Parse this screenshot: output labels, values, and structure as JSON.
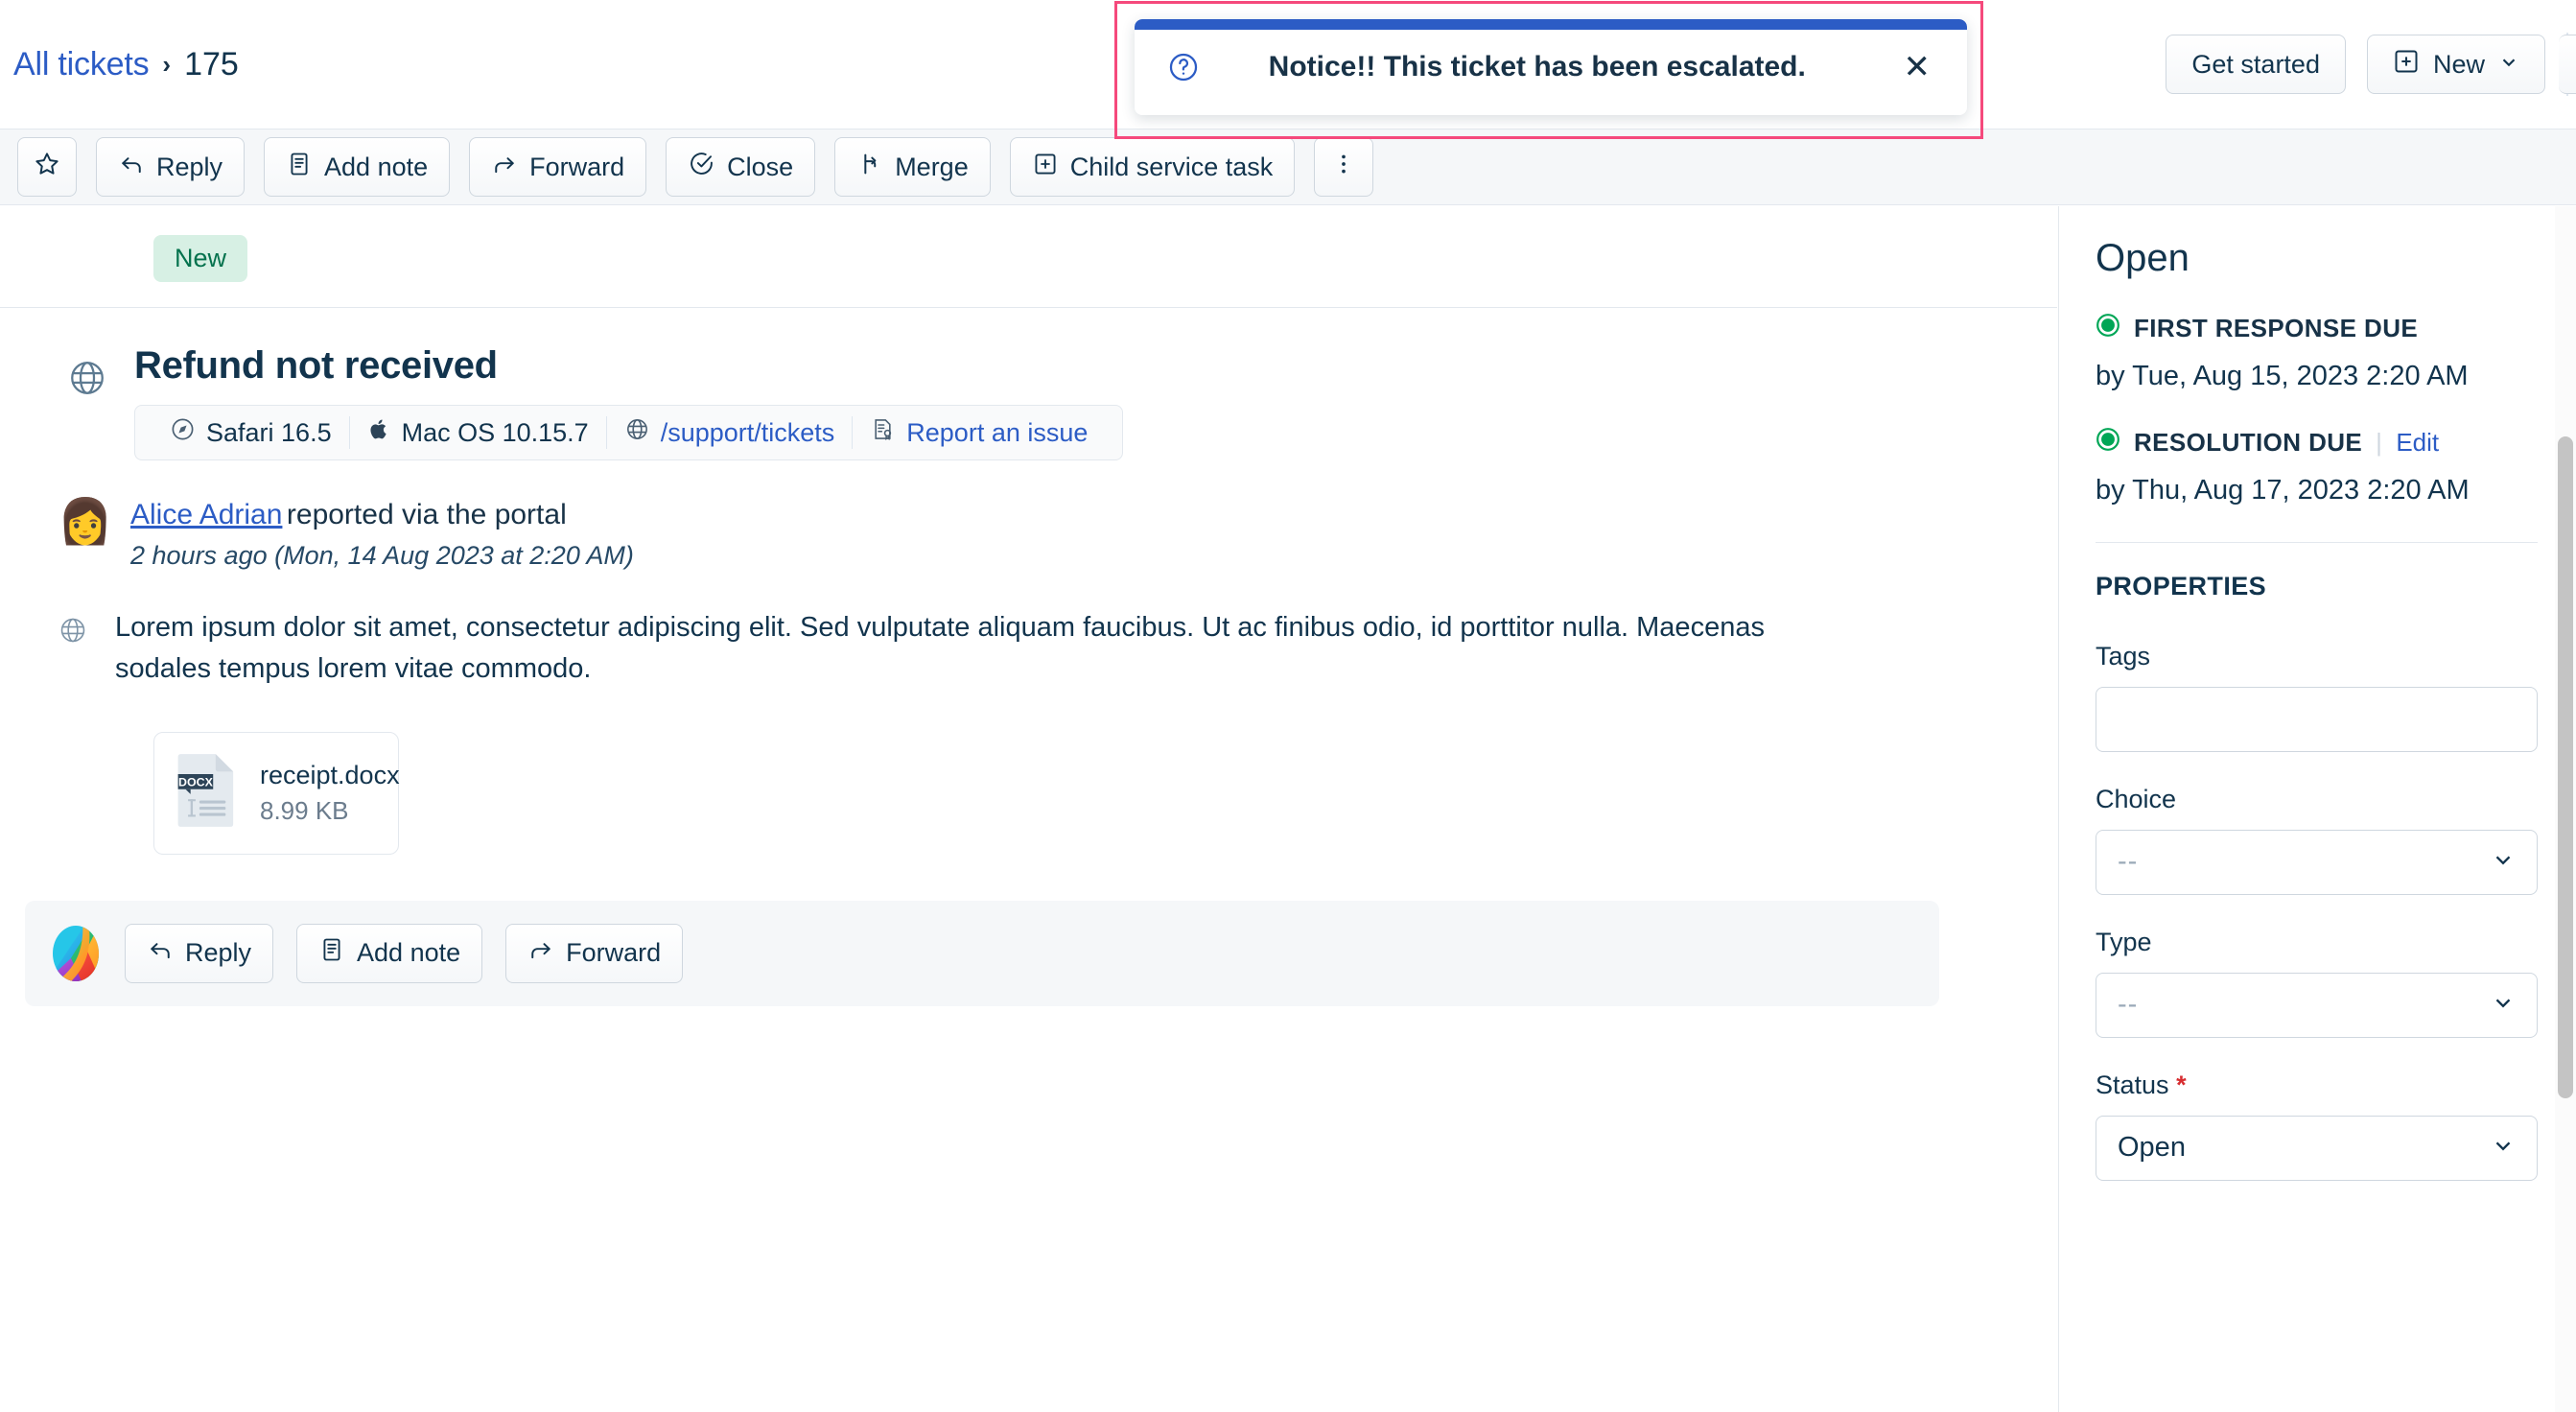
{
  "breadcrumb": {
    "root_label": "All tickets",
    "separator": "›",
    "current_label": "175"
  },
  "header": {
    "get_started_label": "Get started",
    "new_label": "New",
    "new_icon": "plus-square-icon",
    "new_caret": "chevron-down-icon"
  },
  "notification": {
    "icon": "question-circle-icon",
    "message": "Notice!! This ticket has been escalated.",
    "close_label": "✕",
    "accent_color": "#2c5cc5",
    "highlight_border_color": "#f5497c"
  },
  "toolbar": {
    "buttons": [
      {
        "label": "",
        "icon": "star-icon",
        "name": "favorite-button"
      },
      {
        "label": "Reply",
        "icon": "reply-arrow-icon",
        "name": "reply-button"
      },
      {
        "label": "Add note",
        "icon": "note-icon",
        "name": "add-note-button"
      },
      {
        "label": "Forward",
        "icon": "forward-arrow-icon",
        "name": "forward-button"
      },
      {
        "label": "Close",
        "icon": "check-circle-icon",
        "name": "close-ticket-button"
      },
      {
        "label": "Merge",
        "icon": "merge-icon",
        "name": "merge-button"
      },
      {
        "label": "Child service task",
        "icon": "plus-square-icon",
        "name": "child-service-task-button"
      },
      {
        "label": "",
        "icon": "kebab-menu-icon",
        "name": "more-actions-button"
      }
    ]
  },
  "ticket": {
    "status_badge": "New",
    "status_badge_color": "#04724d",
    "status_badge_bg": "#d7f0e4",
    "channel_icon": "globe-icon",
    "title": "Refund not received",
    "meta": [
      {
        "label": "Safari 16.5",
        "icon": "safari-icon",
        "link": false
      },
      {
        "label": "Mac OS 10.15.7",
        "icon": "apple-icon",
        "link": false
      },
      {
        "label": "/support/tickets",
        "icon": "globe-icon",
        "link": true
      },
      {
        "label": "Report an issue",
        "icon": "report-icon",
        "link": true
      }
    ],
    "reporter": {
      "avatar": "woman-avatar",
      "name": "Alice Adrian",
      "action": "reported via the portal",
      "timestamp": "2 hours ago (Mon, 14 Aug 2023 at 2:20 AM)"
    },
    "body": "Lorem ipsum dolor sit amet, consectetur adipiscing elit. Sed vulputate aliquam faucibus. Ut ac finibus odio, id porttitor nulla. Maecenas sodales tempus lorem vitae commodo.",
    "attachment": {
      "type_label": "DOCX",
      "filename": "receipt.docx",
      "filesize": "8.99 KB"
    },
    "reply_bar": {
      "avatar": "brand-logo",
      "buttons": [
        {
          "label": "Reply",
          "icon": "reply-arrow-icon",
          "name": "reply-button"
        },
        {
          "label": "Add note",
          "icon": "note-icon",
          "name": "add-note-button"
        },
        {
          "label": "Forward",
          "icon": "forward-arrow-icon",
          "name": "forward-button"
        }
      ]
    }
  },
  "sidebar": {
    "status_title": "Open",
    "sla": [
      {
        "label": "FIRST RESPONSE DUE",
        "dot_color": "#00a656",
        "value": "by Tue, Aug 15, 2023 2:20 AM",
        "edit_label": ""
      },
      {
        "label": "RESOLUTION DUE",
        "dot_color": "#00a656",
        "value": "by Thu, Aug 17, 2023 2:20 AM",
        "edit_label": "Edit"
      }
    ],
    "properties_heading": "PROPERTIES",
    "fields": [
      {
        "label": "Tags",
        "type": "input",
        "value": "",
        "required": false,
        "name": "tags-input"
      },
      {
        "label": "Choice",
        "type": "select",
        "value": "--",
        "placeholder": true,
        "required": false,
        "name": "choice-select"
      },
      {
        "label": "Type",
        "type": "select",
        "value": "--",
        "placeholder": true,
        "required": false,
        "name": "type-select"
      },
      {
        "label": "Status",
        "type": "select",
        "value": "Open",
        "placeholder": false,
        "required": true,
        "name": "status-select"
      }
    ],
    "required_marker": "*"
  }
}
